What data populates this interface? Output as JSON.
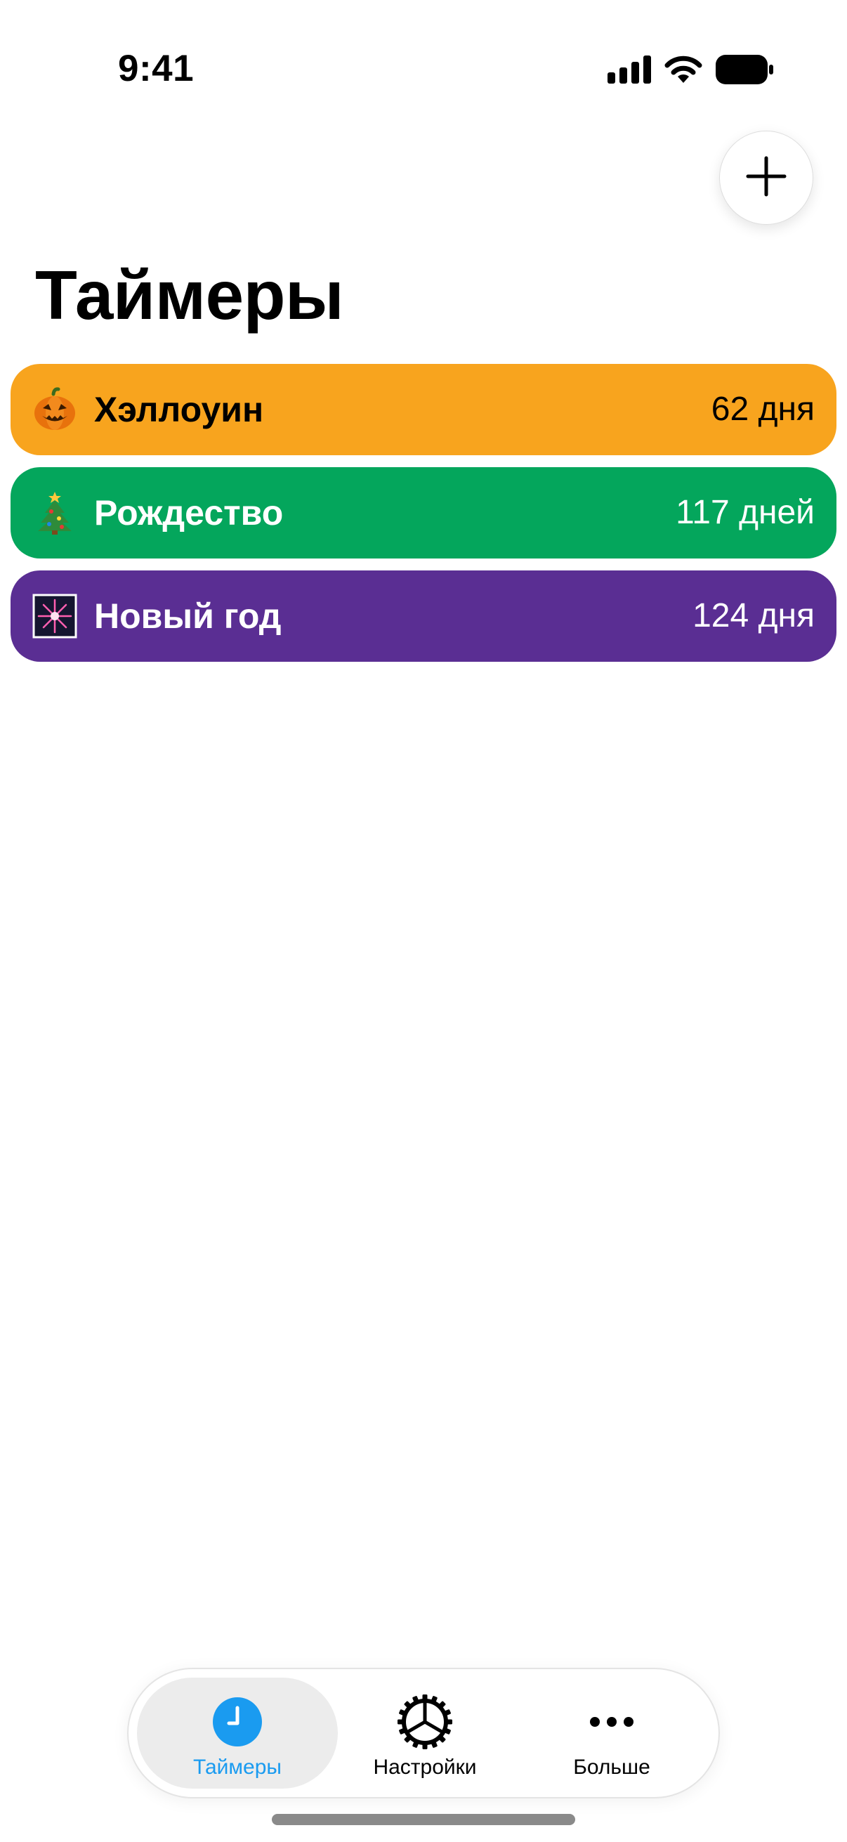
{
  "status_bar": {
    "time": "9:41",
    "icons": [
      "cellular-signal-icon",
      "wifi-icon",
      "battery-icon"
    ]
  },
  "toolbar": {
    "add_icon": "plus-icon"
  },
  "page": {
    "title": "Таймеры"
  },
  "timers": [
    {
      "emoji": "🎃",
      "icon": "jack-o-lantern-icon",
      "name": "Хэллоуин",
      "days": "62 дня",
      "color": "#F8A41E",
      "text_color": "#000000"
    },
    {
      "emoji": "🎄",
      "icon": "christmas-tree-icon",
      "name": "Рождество",
      "days": "117 дней",
      "color": "#04A65C",
      "text_color": "#FFFFFF"
    },
    {
      "emoji": "🎆",
      "icon": "fireworks-icon",
      "name": "Новый год",
      "days": "124 дня",
      "color": "#5A2E93",
      "text_color": "#FFFFFF"
    }
  ],
  "tab_bar": {
    "active_color": "#1A9BF0",
    "tabs": [
      {
        "label": "Таймеры",
        "icon": "clock-icon",
        "active": true
      },
      {
        "label": "Настройки",
        "icon": "gear-icon",
        "active": false
      },
      {
        "label": "Больше",
        "icon": "more-icon",
        "active": false
      }
    ]
  }
}
